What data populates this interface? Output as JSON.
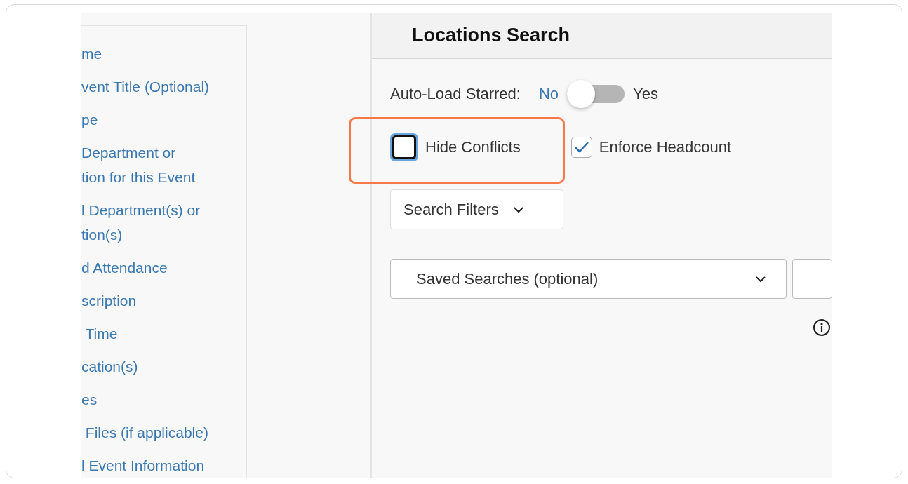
{
  "sidebar": {
    "items": [
      {
        "lines": [
          "me"
        ]
      },
      {
        "lines": [
          "vent Title (Optional)"
        ]
      },
      {
        "lines": [
          "pe"
        ]
      },
      {
        "lines": [
          "Department or",
          "tion for this Event"
        ]
      },
      {
        "lines": [
          "l Department(s) or",
          "tion(s)"
        ]
      },
      {
        "lines": [
          "d Attendance"
        ]
      },
      {
        "lines": [
          "scription"
        ]
      },
      {
        "lines": [
          " Time"
        ]
      },
      {
        "lines": [
          "cation(s)"
        ]
      },
      {
        "lines": [
          "es"
        ]
      },
      {
        "lines": [
          " Files (if applicable)"
        ]
      },
      {
        "lines": [
          "l Event Information"
        ]
      }
    ]
  },
  "panel": {
    "title": "Locations Search",
    "auto_load": {
      "label": "Auto-Load Starred:",
      "off_label": "No",
      "on_label": "Yes",
      "on": false
    },
    "checkboxes": [
      {
        "label": "Hide Conflicts",
        "checked": false,
        "focused": true,
        "highlighted": true
      },
      {
        "label": "Enforce Headcount",
        "checked": true,
        "focused": false,
        "highlighted": false
      }
    ],
    "filters_button": "Search Filters",
    "saved_searches": {
      "placeholder": "Saved Searches (optional)"
    }
  }
}
